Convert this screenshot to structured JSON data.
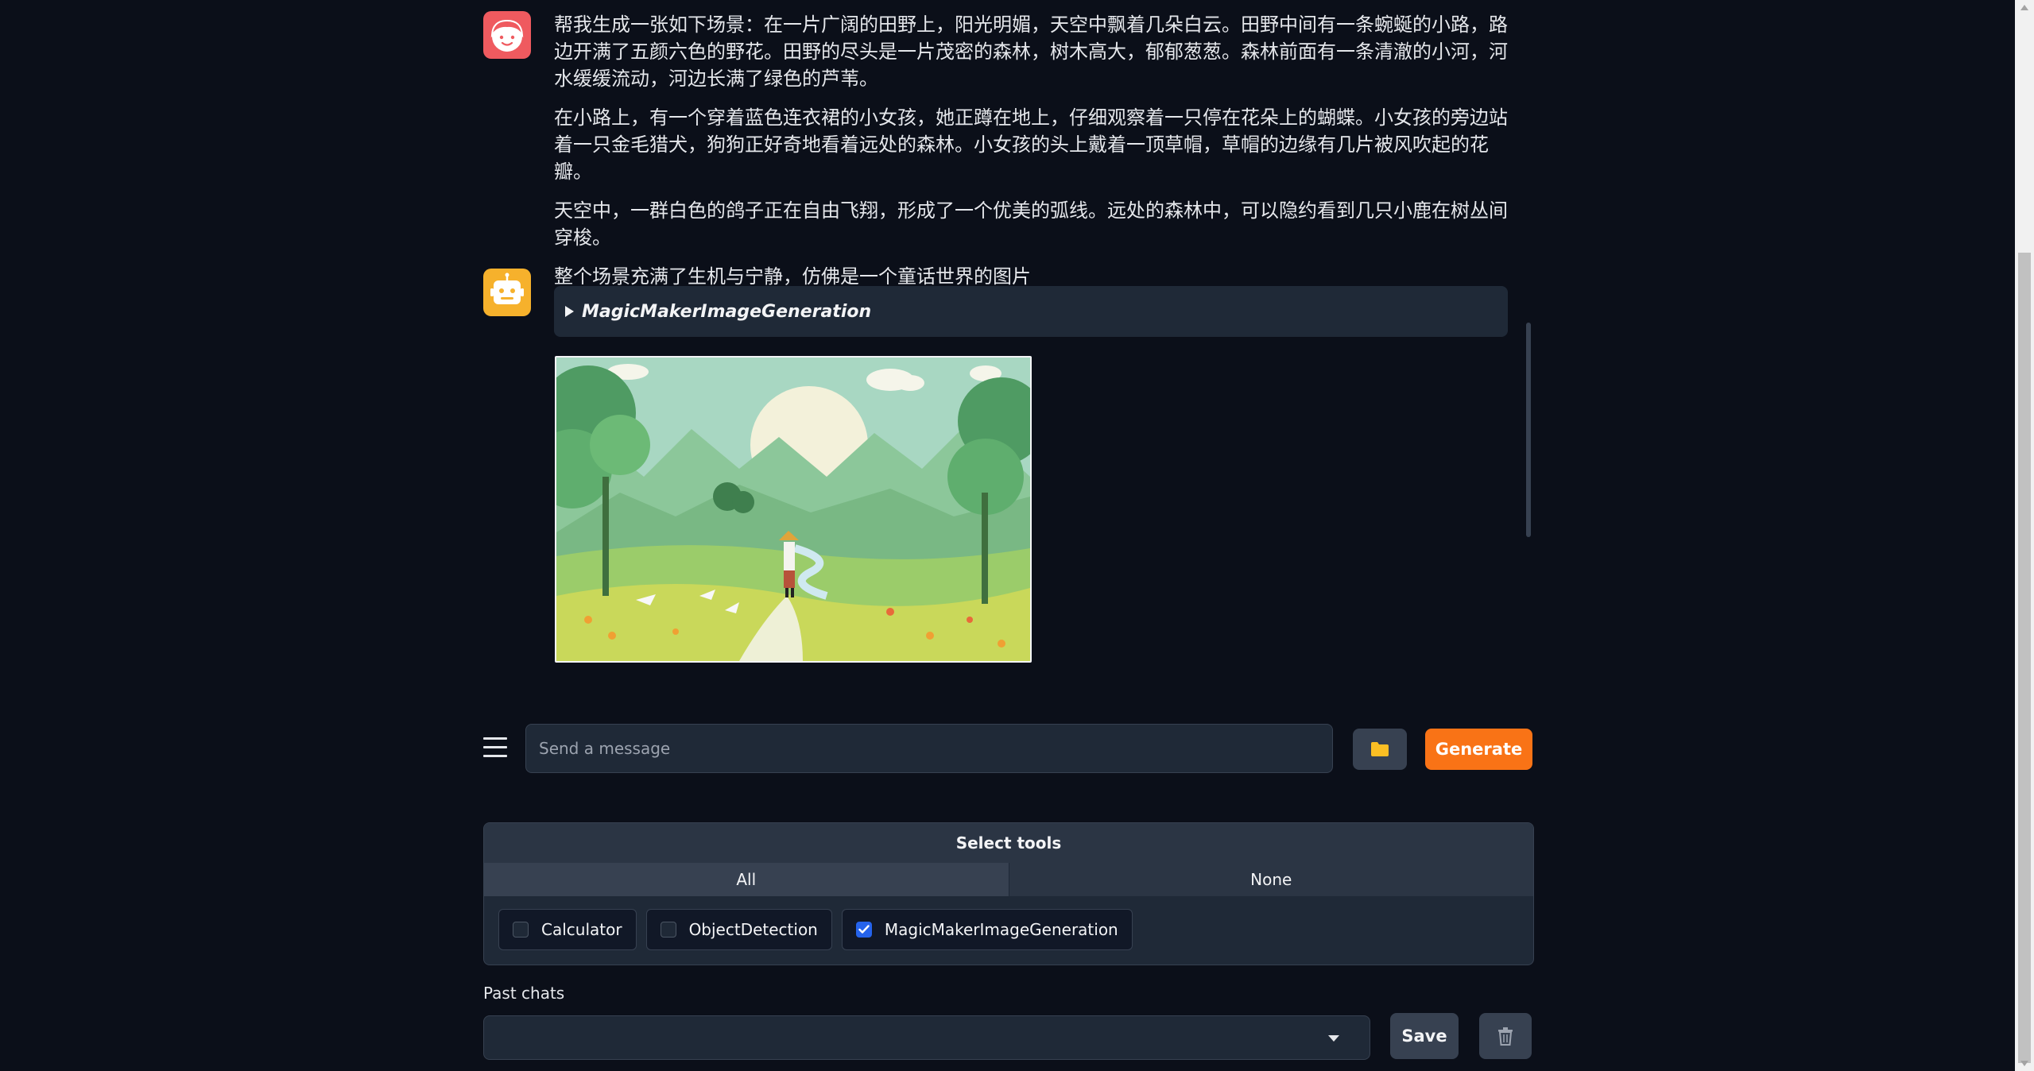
{
  "conversation": {
    "user_message": {
      "paragraphs": [
        "帮我生成一张如下场景：在一片广阔的田野上，阳光明媚，天空中飘着几朵白云。田野中间有一条蜿蜒的小路，路边开满了五颜六色的野花。田野的尽头是一片茂密的森林，树木高大，郁郁葱葱。森林前面有一条清澈的小河，河水缓缓流动，河边长满了绿色的芦苇。",
        "在小路上，有一个穿着蓝色连衣裙的小女孩，她正蹲在地上，仔细观察着一只停在花朵上的蝴蝶。小女孩的旁边站着一只金毛猎犬，狗狗正好奇地看着远处的森林。小女孩的头上戴着一顶草帽，草帽的边缘有几片被风吹起的花瓣。",
        "天空中，一群白色的鸽子正在自由飞翔，形成了一个优美的弧线。远处的森林中，可以隐约看到几只小鹿在树丛间穿梭。",
        "整个场景充满了生机与宁静，仿佛是一个童话世界的图片"
      ]
    },
    "bot_message": {
      "tool_call_label": "MagicMakerImageGeneration"
    }
  },
  "composer": {
    "placeholder": "Send a message",
    "generate_label": "Generate"
  },
  "tools": {
    "title": "Select tools",
    "tabs": [
      "All",
      "None"
    ],
    "options": [
      {
        "label": "Calculator",
        "checked": false
      },
      {
        "label": "ObjectDetection",
        "checked": false
      },
      {
        "label": "MagicMakerImageGeneration",
        "checked": true
      }
    ]
  },
  "past_chats": {
    "label": "Past chats",
    "selected": "",
    "save_label": "Save"
  },
  "colors": {
    "background": "#0b0f19",
    "accent": "#f97316",
    "checkbox_checked": "#2563eb",
    "user_avatar": "#ef5a5f",
    "bot_avatar": "#f6b12c"
  },
  "icons": [
    "user-avatar-icon",
    "robot-avatar-icon",
    "triangle-right-icon",
    "hamburger-menu-icon",
    "folder-icon",
    "check-icon",
    "chevron-down-icon",
    "trash-icon"
  ]
}
